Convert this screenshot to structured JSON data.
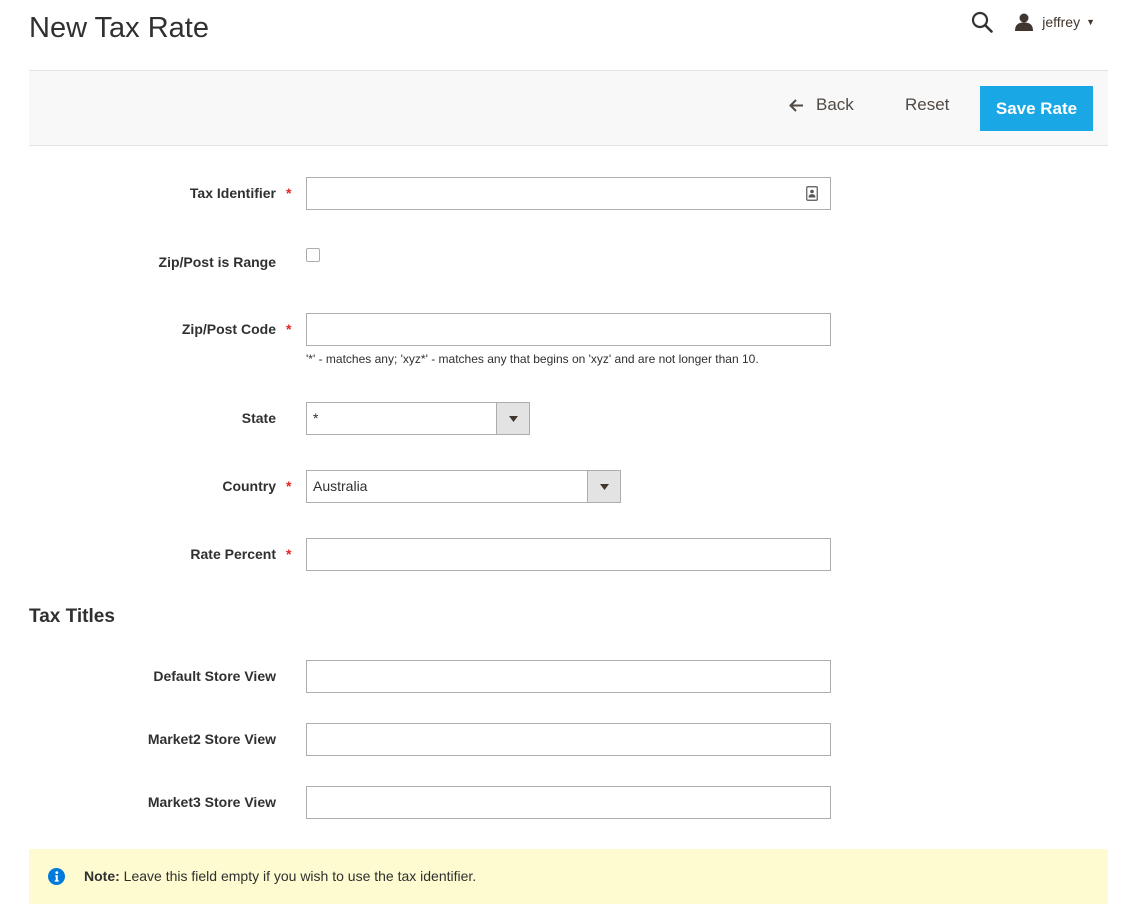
{
  "page": {
    "title": "New Tax Rate"
  },
  "header": {
    "username": "jeffrey"
  },
  "actions": {
    "back_label": "Back",
    "reset_label": "Reset",
    "save_label": "Save Rate"
  },
  "form": {
    "tax_identifier": {
      "label": "Tax Identifier",
      "value": "",
      "required": true
    },
    "zip_is_range": {
      "label": "Zip/Post is Range",
      "checked": false
    },
    "zip_code": {
      "label": "Zip/Post Code",
      "value": "",
      "required": true,
      "note": "'*' - matches any; 'xyz*' - matches any that begins on 'xyz' and are not longer than 10."
    },
    "state": {
      "label": "State",
      "selected": "*"
    },
    "country": {
      "label": "Country",
      "selected": "Australia",
      "required": true
    },
    "rate_percent": {
      "label": "Rate Percent",
      "value": "",
      "required": true
    }
  },
  "tax_titles": {
    "title": "Tax Titles",
    "fields": [
      {
        "label": "Default Store View",
        "value": ""
      },
      {
        "label": "Market2 Store View",
        "value": ""
      },
      {
        "label": "Market3 Store View",
        "value": ""
      }
    ]
  },
  "message": {
    "strong": "Note:",
    "text": " Leave this field empty if you wish to use the tax identifier."
  },
  "colors": {
    "primary_button": "#1aa7e6",
    "required_star": "#e22626",
    "message_bg": "#fdfbcf",
    "info_icon": "#007bdb"
  },
  "icons": {
    "search": "search-icon",
    "user": "user-icon",
    "back": "arrow-left-icon",
    "contact_card": "contact-card-icon",
    "select_arrow": "chevron-down-icon",
    "info": "info-icon"
  }
}
